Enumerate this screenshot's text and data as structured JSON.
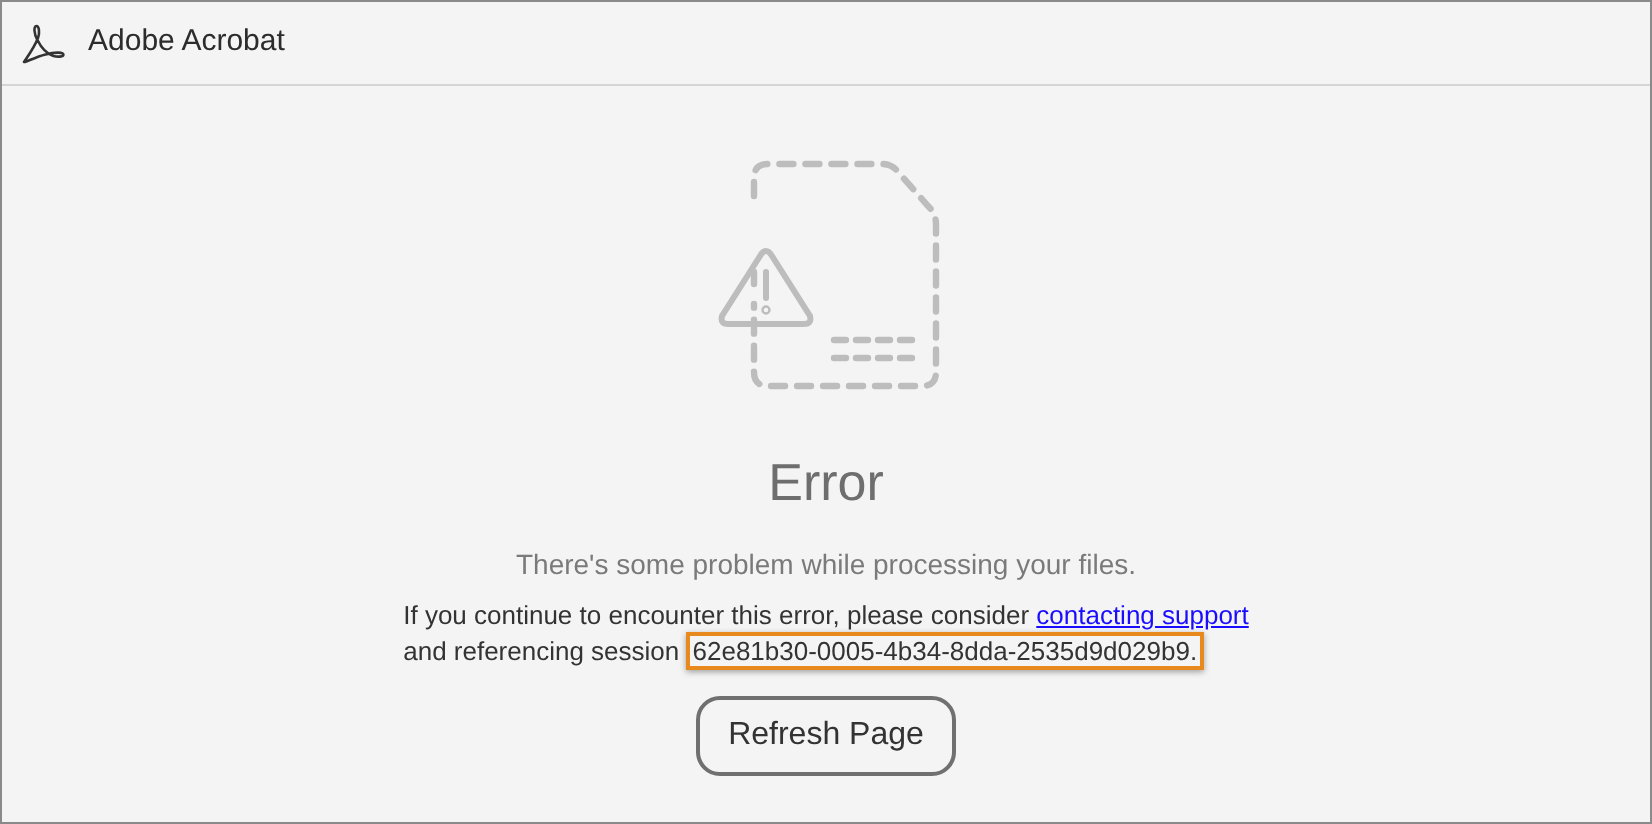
{
  "window": {
    "title": "Adobe Acrobat"
  },
  "error": {
    "heading": "Error",
    "message": "There's some problem while processing your files.",
    "details": {
      "before": "If you continue to encounter this error, please consider",
      "link": "contacting support",
      "middle": "and referencing session",
      "session_id": "62e81b30-0005-4b34-8dda-2535d9d029b9."
    },
    "button": "Refresh Page"
  }
}
